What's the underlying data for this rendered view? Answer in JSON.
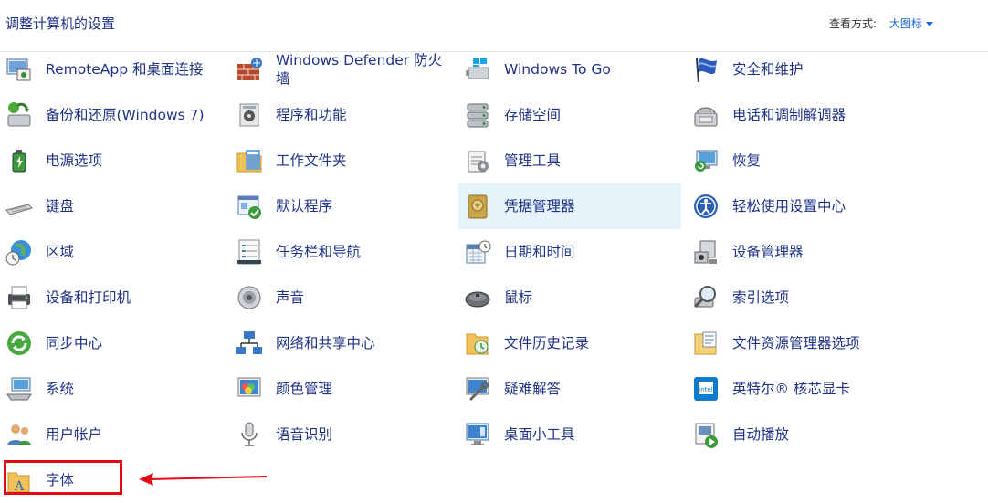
{
  "header": {
    "title": "调整计算机的设置",
    "view_by_label": "查看方式:",
    "view_by_value": "大图标"
  },
  "items": [
    {
      "label": "RemoteApp 和桌面连接",
      "icon": "remoteapp-icon"
    },
    {
      "label": "Windows Defender 防火墙",
      "icon": "firewall-icon"
    },
    {
      "label": "Windows To Go",
      "icon": "windows-to-go-icon"
    },
    {
      "label": "安全和维护",
      "icon": "flag-icon"
    },
    {
      "label": "备份和还原(Windows 7)",
      "icon": "backup-icon"
    },
    {
      "label": "程序和功能",
      "icon": "programs-icon"
    },
    {
      "label": "存储空间",
      "icon": "storage-icon"
    },
    {
      "label": "电话和调制解调器",
      "icon": "phone-modem-icon"
    },
    {
      "label": "电源选项",
      "icon": "power-icon"
    },
    {
      "label": "工作文件夹",
      "icon": "work-folders-icon"
    },
    {
      "label": "管理工具",
      "icon": "admin-tools-icon"
    },
    {
      "label": "恢复",
      "icon": "recovery-icon"
    },
    {
      "label": "键盘",
      "icon": "keyboard-icon"
    },
    {
      "label": "默认程序",
      "icon": "default-programs-icon"
    },
    {
      "label": "凭据管理器",
      "icon": "credential-manager-icon"
    },
    {
      "label": "轻松使用设置中心",
      "icon": "ease-of-access-icon"
    },
    {
      "label": "区域",
      "icon": "region-icon"
    },
    {
      "label": "任务栏和导航",
      "icon": "taskbar-icon"
    },
    {
      "label": "日期和时间",
      "icon": "date-time-icon"
    },
    {
      "label": "设备管理器",
      "icon": "device-manager-icon"
    },
    {
      "label": "设备和打印机",
      "icon": "printer-icon"
    },
    {
      "label": "声音",
      "icon": "sound-icon"
    },
    {
      "label": "鼠标",
      "icon": "mouse-icon"
    },
    {
      "label": "索引选项",
      "icon": "indexing-icon"
    },
    {
      "label": "同步中心",
      "icon": "sync-icon"
    },
    {
      "label": "网络和共享中心",
      "icon": "network-icon"
    },
    {
      "label": "文件历史记录",
      "icon": "file-history-icon"
    },
    {
      "label": "文件资源管理器选项",
      "icon": "explorer-options-icon"
    },
    {
      "label": "系统",
      "icon": "system-icon"
    },
    {
      "label": "颜色管理",
      "icon": "color-management-icon"
    },
    {
      "label": "疑难解答",
      "icon": "troubleshoot-icon"
    },
    {
      "label": "英特尔® 核芯显卡",
      "icon": "intel-graphics-icon"
    },
    {
      "label": "用户帐户",
      "icon": "users-icon"
    },
    {
      "label": "语音识别",
      "icon": "microphone-icon"
    },
    {
      "label": "桌面小工具",
      "icon": "gadgets-icon"
    },
    {
      "label": "自动播放",
      "icon": "autoplay-icon"
    },
    {
      "label": "字体",
      "icon": "fonts-icon"
    }
  ],
  "colors": {
    "link": "#1e3287",
    "highlight": "#e5f3fb",
    "annotation": "#e30b17"
  }
}
